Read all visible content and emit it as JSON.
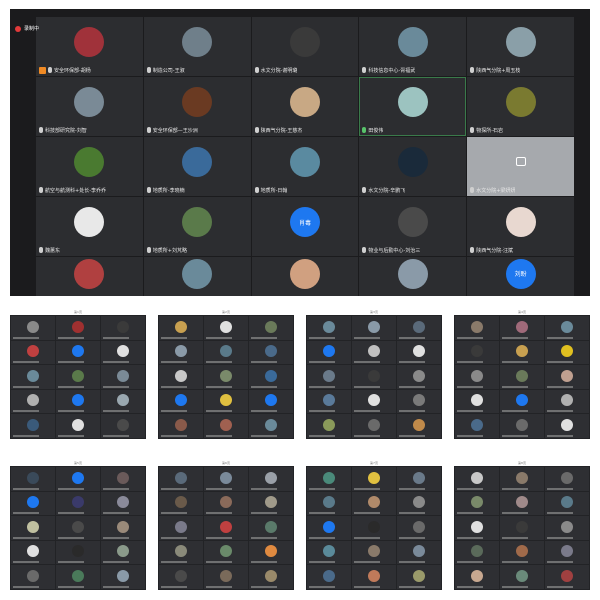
{
  "recording": {
    "label": "录制中"
  },
  "main_grid": {
    "tiles": [
      {
        "name": "安全环保部-胡杨",
        "avatar_color": "#a0323a",
        "hand": true,
        "mic": false
      },
      {
        "name": "制造公司-王淑",
        "avatar_color": "#6f7f8a"
      },
      {
        "name": "水文分院-谢明璐",
        "avatar_color": "#3a3a3a"
      },
      {
        "name": "科技信息中心-胥福武",
        "avatar_color": "#6a8a9a"
      },
      {
        "name": "陕西气分院+周玉枝",
        "avatar_color": "#8a9fa8"
      },
      {
        "name": "科技部研究院-刘智",
        "avatar_color": "#7a8a96"
      },
      {
        "name": "安全环保部—王沙洲",
        "avatar_color": "#6a3a22"
      },
      {
        "name": "陕西气分院-王慈杰",
        "avatar_color": "#c8a884"
      },
      {
        "name": "田俊伟",
        "avatar_color": "#9cc3c0",
        "mic_on": true,
        "active": true
      },
      {
        "name": "物探所-石岩",
        "avatar_color": "#7a7a30"
      },
      {
        "name": "航空与航测科+处长-李乔乔",
        "avatar_color": "#4a7a30"
      },
      {
        "name": "地质所-李晓楠",
        "avatar_color": "#3a6a9a"
      },
      {
        "name": "地质所-日翰",
        "avatar_color": "#5a8aa0"
      },
      {
        "name": "水文分院-辛鹏飞",
        "avatar_color": "#1a2a3a"
      },
      {
        "name": "水文分院+梁妍妍",
        "avatar_color": "",
        "gray": true
      },
      {
        "name": "魏蕙东",
        "avatar_color": "#e8e8e8"
      },
      {
        "name": "地质所+刘芃略",
        "avatar_color": "#5a7a4a"
      },
      {
        "name": "",
        "avatar_text": "肖毒",
        "avatar_color": "#1e78f0"
      },
      {
        "name": "物业与后勤中心-刘治三",
        "avatar_color": "#4a4a4a"
      },
      {
        "name": "陕西气分院-汪斌",
        "avatar_color": "#e8d8d0"
      },
      {
        "name": "",
        "avatar_color": "#b04040"
      },
      {
        "name": "",
        "avatar_color": "#6a8a9a"
      },
      {
        "name": "",
        "avatar_color": "#d0a080"
      },
      {
        "name": "",
        "avatar_color": "#8a9aa8"
      },
      {
        "name": "",
        "avatar_text": "刘盼",
        "avatar_color": "#1e78f0"
      }
    ]
  },
  "thumbnails": [
    {
      "title": "第1页",
      "colors": [
        "#8a8a8a",
        "#a03030",
        "#3a3a3a",
        "#c04040",
        "#1e78f0",
        "#e0e0e0",
        "#6a8a9a",
        "#5a7a4a",
        "#7a8a96",
        "#b0b0b0",
        "#1e78f0",
        "#9aa8b0",
        "#3a5a7a",
        "#e0e0e0",
        "#4a4a4a"
      ]
    },
    {
      "title": "第2页",
      "colors": [
        "#c8a050",
        "#e0e0e0",
        "#6a7a5a",
        "#8a9aa8",
        "#5a7a8a",
        "#4a6a8a",
        "#c8c8c8",
        "#7a8a6a",
        "#3a6a9a",
        "#1e78f0",
        "#e0c040",
        "#1e78f0",
        "#8a5a4a",
        "#a06050",
        "#6a8a9a"
      ]
    },
    {
      "title": "第3页",
      "colors": [
        "#6a8a9a",
        "#8a9aa8",
        "#5a6a7a",
        "#1e78f0",
        "#c0c0c0",
        "#e0e0e0",
        "#6a7a8a",
        "#3a3a3a",
        "#8a8a8a",
        "#5a7a9a",
        "#e0e0e0",
        "#7a7a7a",
        "#8a9a5a",
        "#6a6a6a",
        "#c08a4a"
      ]
    },
    {
      "title": "第4页",
      "colors": [
        "#8a7a6a",
        "#a06a7a",
        "#6a8a9a",
        "#3a3a3a",
        "#c8a050",
        "#e0c020",
        "#8a8a8a",
        "#6a7a5a",
        "#c0a090",
        "#e0e0e0",
        "#1e78f0",
        "#b0b0b0",
        "#4a6a8a",
        "#6a6a6a",
        "#e0e0e0"
      ]
    },
    {
      "title": "第5页",
      "colors": [
        "#3a4a5a",
        "#1e78f0",
        "#6a5a5a",
        "#1e78f0",
        "#3a3a6a",
        "#8a8a9a",
        "#c0c0a0",
        "#4a4a4a",
        "#9a8a7a",
        "#e0e0e0",
        "#2a2a2a",
        "#8a9a8a",
        "#6a6a6a",
        "#4a7a5a",
        "#8a9aa8"
      ]
    },
    {
      "title": "第6页",
      "colors": [
        "#5a6a7a",
        "#7a8a9a",
        "#9aa0a8",
        "#6a5a4a",
        "#8a6a5a",
        "#a09a8a",
        "#7a7a8a",
        "#c04040",
        "#5a7a6a",
        "#8a8a7a",
        "#6a8a6a",
        "#e08a40",
        "#4a4a4a",
        "#7a6a5a",
        "#9a8a6a"
      ]
    },
    {
      "title": "第7页",
      "colors": [
        "#4a8a7a",
        "#e0c040",
        "#6a7a8a",
        "#5a7a8a",
        "#b08a6a",
        "#8a8a8a",
        "#1e78f0",
        "#2a2a2a",
        "#6a6a6a",
        "#5a8a9a",
        "#8a7a6a",
        "#7a8a9a",
        "#4a6a8a",
        "#c07a5a",
        "#9a9a6a"
      ]
    },
    {
      "title": "第8页",
      "colors": [
        "#c8c8c8",
        "#8a7a6a",
        "#6a6a6a",
        "#7a8a6a",
        "#a08a8a",
        "#5a7a8a",
        "#e0e0e0",
        "#3a3a3a",
        "#8a8a8a",
        "#5a6a5a",
        "#a06a4a",
        "#7a7a8a",
        "#c8a890",
        "#6a8a7a",
        "#a04040"
      ]
    }
  ]
}
